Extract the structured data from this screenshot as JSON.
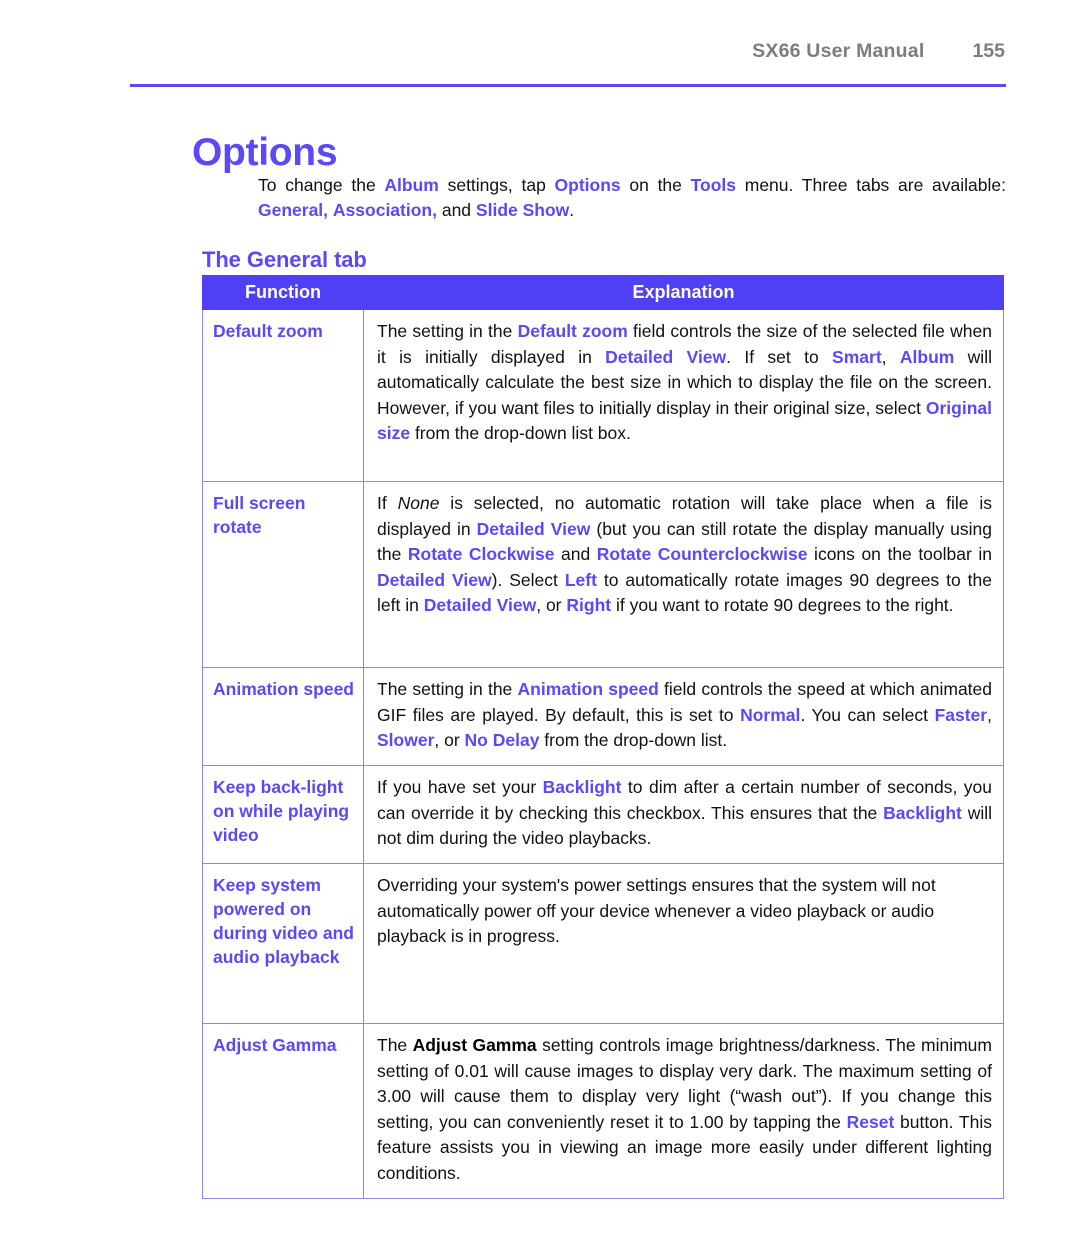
{
  "header": {
    "manual_title": "SX66 User Manual",
    "page_number": "155"
  },
  "page_title": "Options",
  "intro": {
    "line1_a": "To change the ",
    "album": "Album",
    "line1_b": " settings, tap ",
    "options": "Options",
    "line1_c": " on the ",
    "tools": "Tools",
    "line1_d": " menu. Three tabs are available: ",
    "general": "General,",
    "association": "Association,",
    "line1_e": " and ",
    "slide_show": "Slide Show",
    "line1_f": "."
  },
  "subheading": "The General tab",
  "table": {
    "columns": [
      "Function",
      "Explanation"
    ],
    "rows": [
      {
        "function": "Default zoom",
        "explanation_plain": "The setting in the Default zoom field controls the size of the selected file when it is initially displayed in Detailed View. If set to Smart, Album will automatically calculate the best size in which to display the file on the screen. However, if you want files to initially display in their original size, select Original size from the drop-down list box.",
        "parts": [
          {
            "t": "The setting in the ",
            "s": "n"
          },
          {
            "t": "Default zoom",
            "s": "k"
          },
          {
            "t": " field controls the size of the selected file when it is initially displayed in ",
            "s": "n"
          },
          {
            "t": "Detailed View",
            "s": "k"
          },
          {
            "t": ". If set to ",
            "s": "n"
          },
          {
            "t": "Smart",
            "s": "k"
          },
          {
            "t": ", ",
            "s": "n"
          },
          {
            "t": "Album",
            "s": "k"
          },
          {
            "t": " will automatically calculate the best size in which to display the file on the screen. However, if you want files to initially display in their original size, select ",
            "s": "n"
          },
          {
            "t": "Original size",
            "s": "k"
          },
          {
            "t": " from the drop-down list box.",
            "s": "n"
          }
        ]
      },
      {
        "function": "Full screen rotate",
        "explanation_plain": "If None is selected, no automatic rotation will take place when a file is displayed in Detailed View (but you can still rotate the display manually using the Rotate Clockwise and Rotate Counterclockwise icons on the toolbar in Detailed View). Select Left to automatically rotate images 90 degrees to the left in Detailed View, or Right if you want to rotate 90 degrees to the right.",
        "parts": [
          {
            "t": "If ",
            "s": "n"
          },
          {
            "t": "None",
            "s": "it"
          },
          {
            "t": " is selected, no automatic rotation will take place when a file is displayed in ",
            "s": "n"
          },
          {
            "t": "Detailed View",
            "s": "k"
          },
          {
            "t": " (but you can still rotate the display manually using the ",
            "s": "n"
          },
          {
            "t": "Rotate Clockwise",
            "s": "k"
          },
          {
            "t": " and ",
            "s": "n"
          },
          {
            "t": "Rotate Counterclockwise",
            "s": "k"
          },
          {
            "t": " icons on the toolbar in ",
            "s": "n"
          },
          {
            "t": "Detailed View",
            "s": "k"
          },
          {
            "t": "). Select ",
            "s": "n"
          },
          {
            "t": "Left",
            "s": "k"
          },
          {
            "t": " to automatically rotate images 90 degrees to the left in ",
            "s": "n"
          },
          {
            "t": "Detailed View",
            "s": "k"
          },
          {
            "t": ", or ",
            "s": "n"
          },
          {
            "t": "Right",
            "s": "k"
          },
          {
            "t": " if you want to rotate 90 degrees to the right.",
            "s": "n"
          }
        ]
      },
      {
        "function": "Animation speed",
        "explanation_plain": "The setting in the Animation speed field controls the speed at which animated GIF files are played. By default, this is set to Normal. You can select Faster, Slower, or No Delay from the drop-down list.",
        "parts": [
          {
            "t": "The setting in the ",
            "s": "n"
          },
          {
            "t": "Animation speed",
            "s": "k"
          },
          {
            "t": " field controls the speed at which animated GIF files are played. By default, this is set to ",
            "s": "n"
          },
          {
            "t": "Normal",
            "s": "k"
          },
          {
            "t": ". You can select ",
            "s": "n"
          },
          {
            "t": "Faster",
            "s": "k"
          },
          {
            "t": ", ",
            "s": "n"
          },
          {
            "t": "Slower",
            "s": "k"
          },
          {
            "t": ", or ",
            "s": "n"
          },
          {
            "t": "No Delay",
            "s": "k"
          },
          {
            "t": " from the drop-down list.",
            "s": "n"
          }
        ]
      },
      {
        "function": "Keep back-light on while playing video",
        "explanation_plain": "If you have set your Backlight to dim after a certain number of seconds, you can override it by checking this checkbox. This ensures that the Backlight will not dim during the video playbacks.",
        "parts": [
          {
            "t": "If you have set your ",
            "s": "n"
          },
          {
            "t": "Backlight",
            "s": "k"
          },
          {
            "t": " to dim after a certain number of seconds, you can override it by checking this checkbox. This ensures that the ",
            "s": "n"
          },
          {
            "t": "Backlight",
            "s": "k"
          },
          {
            "t": " will not dim during the video playbacks.",
            "s": "n"
          }
        ]
      },
      {
        "function": "Keep system powered on during video and audio playback",
        "explanation_plain": "Overriding your system's power settings ensures that the system will not automatically power off your device whenever a video playback or audio playback is in progress.",
        "parts": [
          {
            "t": "Overriding your system's power settings ensures that the system will not automatically power off your device whenever a video playback or audio playback is in progress.",
            "s": "n"
          }
        ]
      },
      {
        "function": "Adjust Gamma",
        "explanation_plain": "The Adjust Gamma setting controls image brightness/darkness. The minimum setting of 0.01 will cause images to display very dark. The maximum setting of 3.00 will cause them to display very light (“wash out”). If you change this setting, you can conveniently reset it to 1.00 by tapping the Reset button. This feature assists you in viewing an image more easily under different lighting conditions.",
        "parts": [
          {
            "t": "The ",
            "s": "n"
          },
          {
            "t": "Adjust Gamma",
            "s": "bb"
          },
          {
            "t": " setting controls image brightness/darkness. The minimum setting of 0.01 will cause images to display very dark. The maximum setting of 3.00 will cause them to display very light (“wash out”). If you change this setting, you can conveniently reset it to 1.00 by tapping the ",
            "s": "n"
          },
          {
            "t": "Reset",
            "s": "k"
          },
          {
            "t": " button. This feature assists you in viewing an image more easily under different lighting conditions.",
            "s": "n"
          }
        ]
      }
    ]
  },
  "colors": {
    "accent": "#5a49f8",
    "header_fill": "#5040f5",
    "border": "#8f86e6",
    "header_text": "#7d7d7d",
    "body_text": "#111111"
  }
}
